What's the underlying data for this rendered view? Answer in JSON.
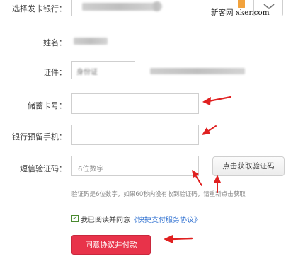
{
  "form": {
    "bank_label": "选择发卡银行：",
    "name_label": "姓名：",
    "id_label": "证件：",
    "id_type_value": "身份证",
    "card_label": "储蓄卡号：",
    "phone_label": "银行预留手机：",
    "sms_label": "短信验证码：",
    "sms_placeholder": "6位数字",
    "get_code_button": "点击获取验证码",
    "sms_hint": "验证码是6位数字，如果60秒内没有收到验证码，请重新点击获取",
    "agree_prefix": "我已阅读并同意",
    "agree_link": "《快捷支付服务协议》",
    "submit_button": "同意协议并付款"
  },
  "watermark": {
    "text": "新客网 xker.com"
  },
  "colors": {
    "accent_red": "#e8334a",
    "link_blue": "#2d6fd0",
    "annotation_arrow": "#e02020"
  },
  "icons": [
    "chevron-down-icon",
    "checkmark-icon",
    "annotation-arrow-icon"
  ]
}
